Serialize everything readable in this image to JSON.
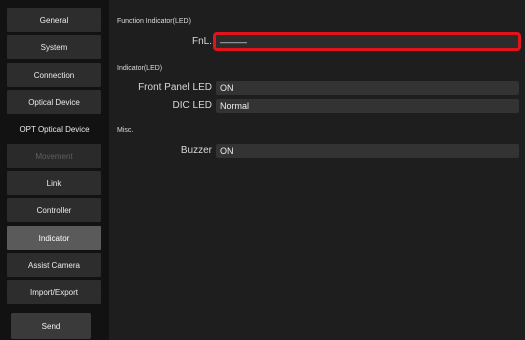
{
  "sidebar": {
    "items": [
      {
        "label": "General"
      },
      {
        "label": "System"
      },
      {
        "label": "Connection"
      },
      {
        "label": "Optical Device"
      },
      {
        "label": "OPT Optical Device"
      },
      {
        "label": "Movement"
      },
      {
        "label": "Link"
      },
      {
        "label": "Controller"
      },
      {
        "label": "Indicator"
      },
      {
        "label": "Assist Camera"
      },
      {
        "label": "Import/Export"
      }
    ],
    "selected": "Indicator",
    "disabled": [
      "Movement"
    ],
    "send_label": "Send"
  },
  "main": {
    "function_indicator": {
      "header": "Function Indicator(LED)",
      "fnl_label": "FnL.",
      "fnl_value": "———"
    },
    "indicator": {
      "header": "Indicator(LED)",
      "front_panel_label": "Front Panel LED",
      "front_panel_value": "ON",
      "dic_label": "DIC LED",
      "dic_value": "Normal"
    },
    "misc": {
      "header": "Misc.",
      "buzzer_label": "Buzzer",
      "buzzer_value": "ON"
    }
  },
  "colors": {
    "highlight": "#e0141a",
    "background": "#1e1e1e",
    "sidebar": "#121212",
    "field": "#333333",
    "selected_item": "#5a5a5a"
  }
}
